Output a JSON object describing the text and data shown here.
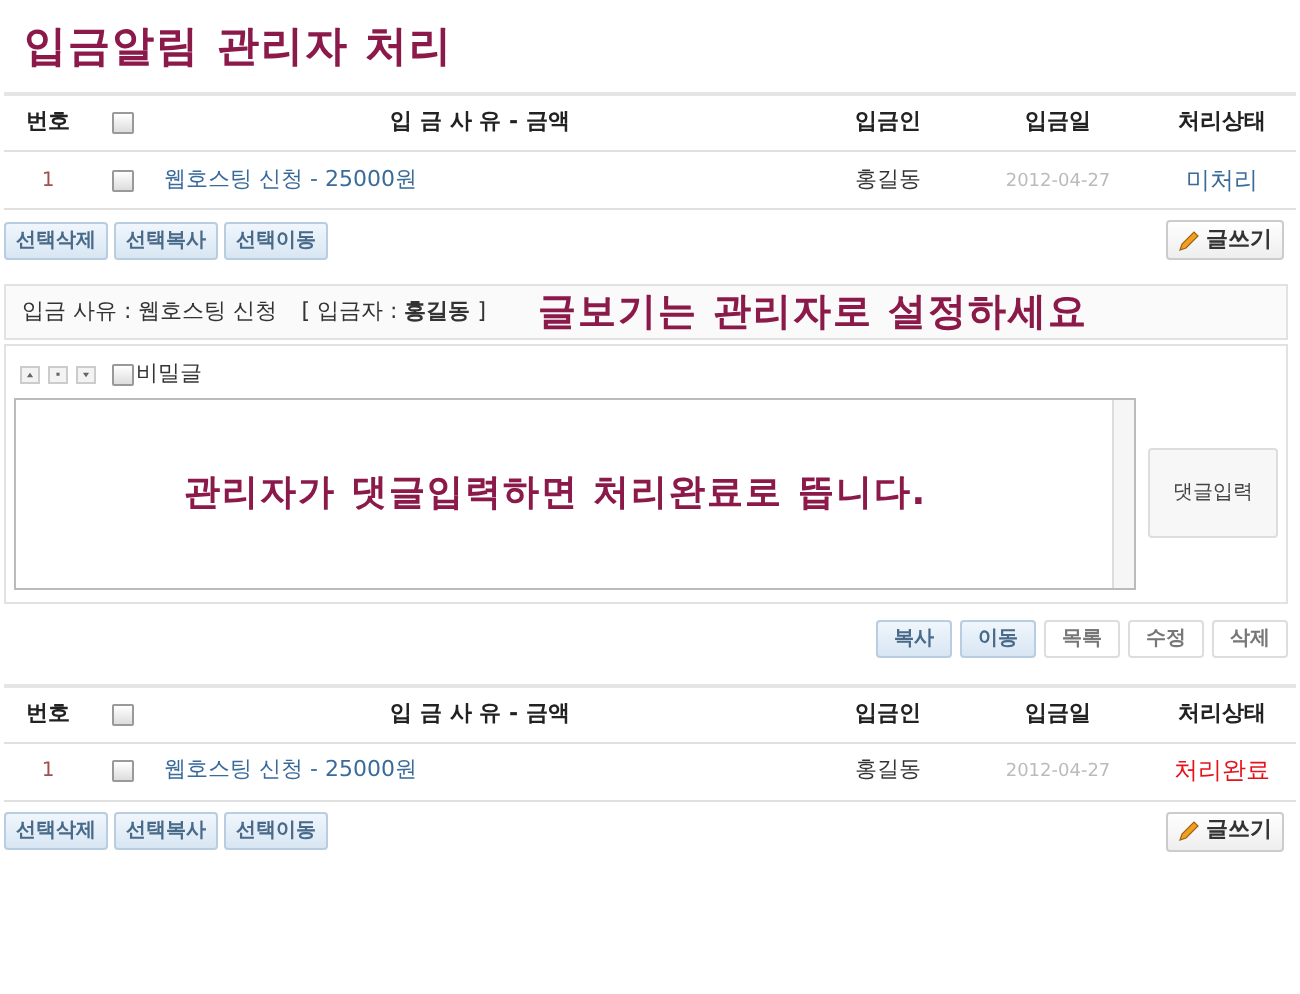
{
  "title": "입금알림 관리자 처리",
  "list_top": {
    "columns": [
      "번호",
      "입 금 사 유 - 금액",
      "입금인",
      "입금일",
      "처리상태"
    ],
    "header_checked": false,
    "rows": [
      {
        "number": "1",
        "checked": false,
        "subject": "웹호스팅 신청 - 25000원",
        "depositor": "홍길동",
        "date": "2012-04-27",
        "status": "미처리",
        "done": false
      }
    ],
    "actions": [
      "선택삭제",
      "선택복사",
      "선택이동"
    ],
    "write_button": "글쓰기"
  },
  "view": {
    "info": "입금 사유 : 웹호스팅 신청",
    "depositor": "[ 입금자 : **홍길동** ]",
    "notice": "글보기는 관리자로 설정하세요",
    "secret_label": "비밀글",
    "secret_checked": false,
    "comment_notice": "관리자가 댓글입력하면 처리완료로 뜹니다.",
    "submit_button": "댓글입력"
  },
  "view_buttons": [
    {
      "label": "복사",
      "kind": "admin"
    },
    {
      "label": "이동",
      "kind": "admin"
    },
    {
      "label": "목록",
      "kind": "plain"
    },
    {
      "label": "수정",
      "kind": "plain"
    },
    {
      "label": "삭제",
      "kind": "plain"
    }
  ],
  "list_bottom": {
    "columns": [
      "번호",
      "입 금 사 유 - 금액",
      "입금인",
      "입금일",
      "처리상태"
    ],
    "header_checked": false,
    "rows": [
      {
        "number": "1",
        "checked": false,
        "subject": "웹호스팅 신청 - 25000원",
        "depositor": "홍길동",
        "date": "2012-04-27",
        "status": "처리완료",
        "done": true
      }
    ],
    "actions": [
      "선택삭제",
      "선택복사",
      "선택이동"
    ],
    "write_button": "글쓰기"
  }
}
